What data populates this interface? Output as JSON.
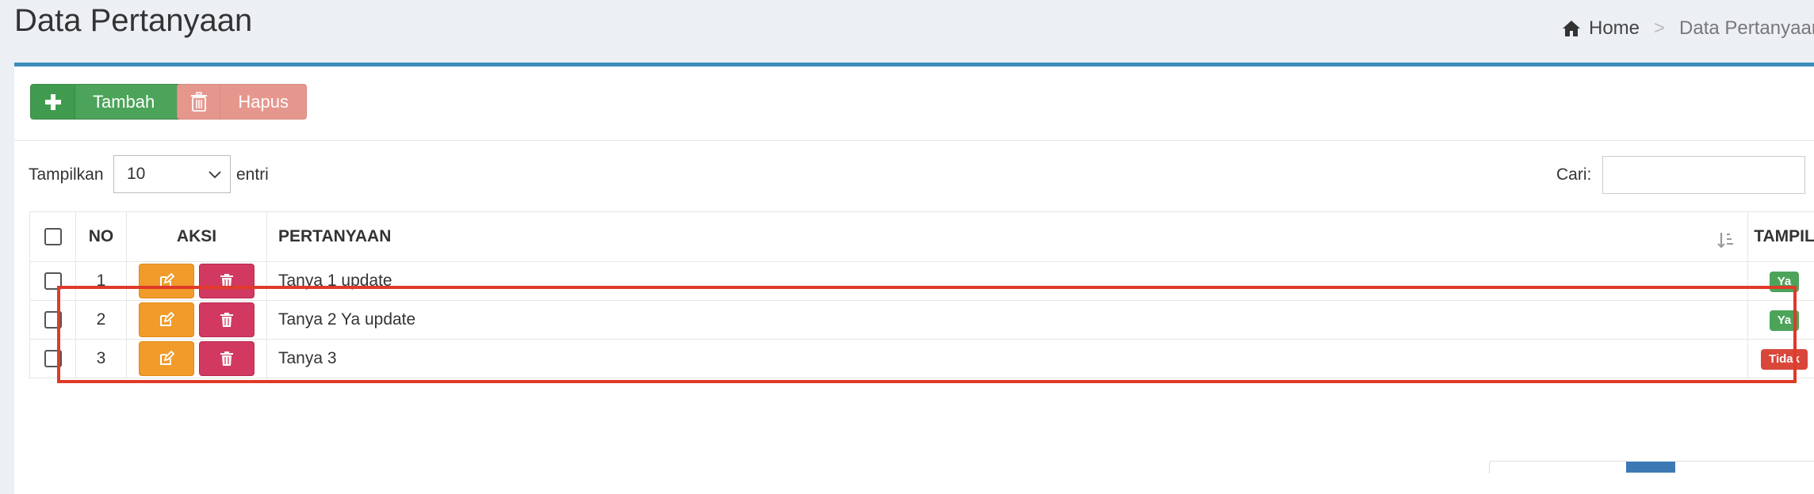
{
  "page": {
    "title": "Data Pertanyaan"
  },
  "breadcrumb": {
    "home": "Home",
    "separator": ">",
    "current": "Data Pertanyaan"
  },
  "toolbar": {
    "add_label": "Tambah",
    "delete_label": "Hapus",
    "add_icon": "plus-icon",
    "delete_icon": "trash-icon"
  },
  "table_controls": {
    "length_prefix": "Tampilkan",
    "length_value": "10",
    "length_suffix": "entri",
    "search_label": "Cari:",
    "search_value": ""
  },
  "table": {
    "columns": [
      "NO",
      "AKSI",
      "PERTANYAAN",
      "TAMPIL"
    ],
    "rows": [
      {
        "no": "1",
        "question": "Tanya 1 update",
        "status": "Ya"
      },
      {
        "no": "2",
        "question": "Tanya 2 Ya update",
        "status": "Ya"
      },
      {
        "no": "3",
        "question": "Tanya 3",
        "status": "Tidak"
      }
    ]
  },
  "colors": {
    "accent": "#3c8dbc",
    "badge_yes": "#4ca35a",
    "badge_no": "#d9473b",
    "highlight": "#e03a2a"
  }
}
